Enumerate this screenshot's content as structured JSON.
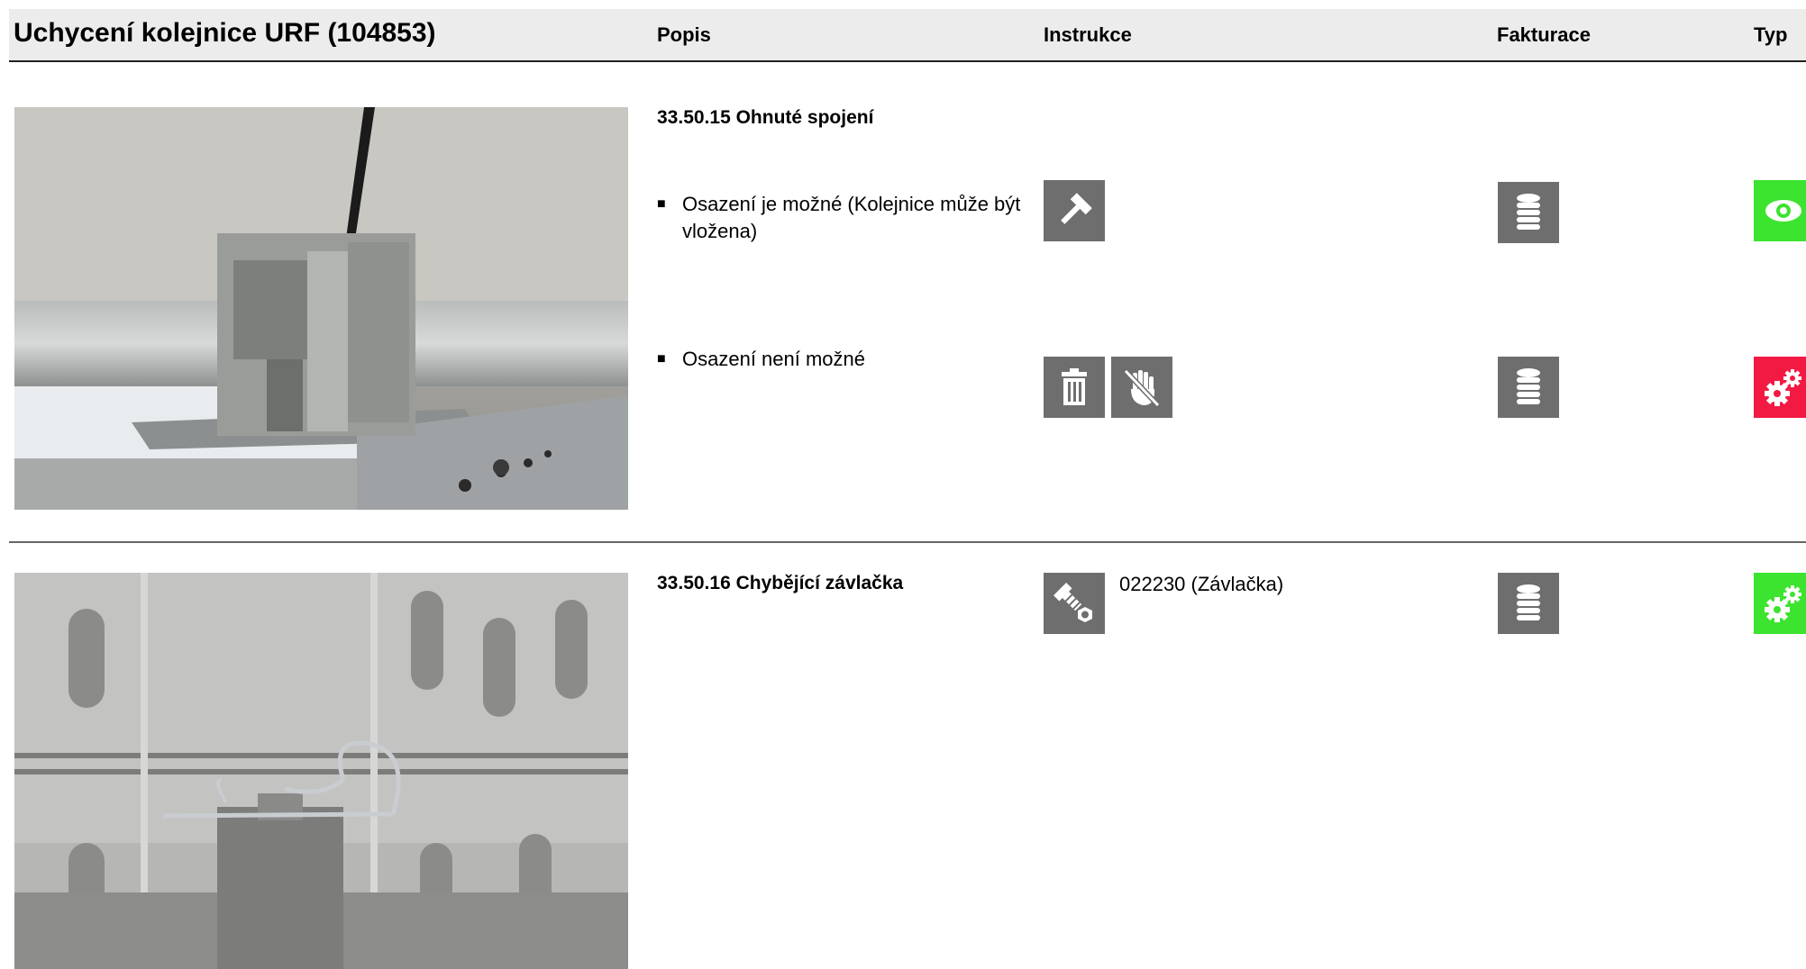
{
  "header": {
    "title": "Uchycení kolejnice URF (104853)",
    "col_popis": "Popis",
    "col_instrukce": "Instrukce",
    "col_fakturace": "Fakturace",
    "col_typ": "Typ"
  },
  "colors": {
    "header_bg": "#ececec",
    "icon_gray": "#6e6e6e",
    "type_green": "#3ce32f",
    "type_red": "#f21a43"
  },
  "sections": [
    {
      "title": "33.50.15 Ohnuté spojení",
      "rows": [
        {
          "bullet": "■",
          "text": "Osazení je možné (Kolejnice může být vložena)",
          "instruction_icons": [
            "hammer-icon"
          ],
          "billing_icon": "coins-stack-icon",
          "type_icon": "eye-icon",
          "type_color": "green"
        },
        {
          "bullet": "■",
          "text": "Osazení není možné",
          "instruction_icons": [
            "trash-icon",
            "no-touch-hand-icon"
          ],
          "billing_icon": "coins-stack-icon",
          "type_icon": "gears-icon",
          "type_color": "red"
        }
      ]
    },
    {
      "title": "33.50.16  Chybějící závlačka",
      "rows": [
        {
          "part_text": "022230 (Závlačka)",
          "instruction_icons": [
            "bolt-nut-icon"
          ],
          "billing_icon": "coins-stack-icon",
          "type_icon": "gears-icon",
          "type_color": "green"
        }
      ]
    }
  ]
}
